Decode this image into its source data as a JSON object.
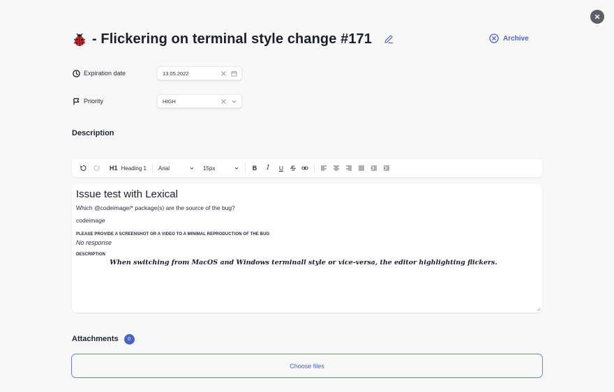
{
  "modal": {
    "close_label": "✕"
  },
  "header": {
    "title": " - Flickering on terminal style change #171",
    "archive_label": "Archive"
  },
  "fields": {
    "expiration": {
      "label": "Expiration date",
      "value": "13.05.2022"
    },
    "priority": {
      "label": "Priority",
      "value": "HIGH"
    }
  },
  "description": {
    "section_title": "Description"
  },
  "toolbar": {
    "heading_tag": "H1",
    "heading_label": "Heading 1",
    "font_family": "Arial",
    "font_size": "15px",
    "bold": "B",
    "italic": "I",
    "underline": "U"
  },
  "editor": {
    "h1": "Issue test with Lexical",
    "question": "Which @codeimage/* package(s) are the source of the bug?",
    "answer": "codeimage",
    "label_repro": "PLEASE PROVIDE A SCREENSHOT OR A VIDEO TO A MINIMAL REPRODUCTION OF THE BUG",
    "no_response": "No response",
    "label_description": "DESCRIPTION",
    "description_text": "When switching from MacOS and Windows terminall style or vice-versa, the editor highlighting flickers."
  },
  "attachments": {
    "title": "Attachments",
    "count": "0",
    "choose_label": "Choose files"
  },
  "colors": {
    "accent": "#4a64c4",
    "background": "#f8f8f8",
    "text": "#1f2330"
  }
}
